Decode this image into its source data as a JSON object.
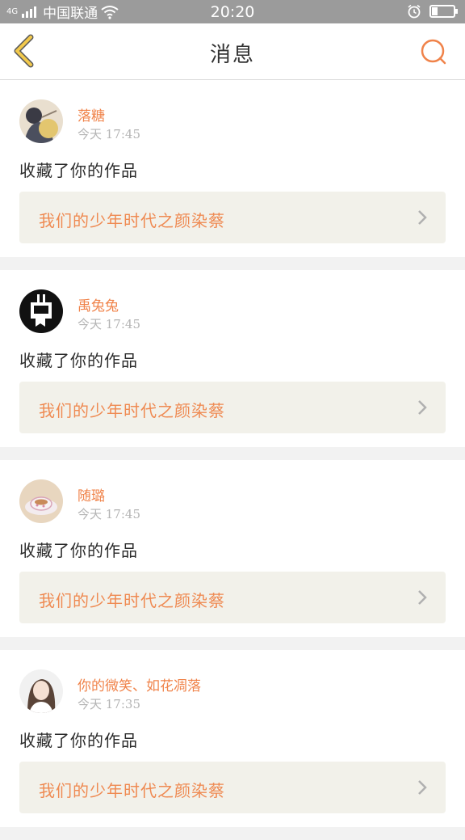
{
  "status_bar": {
    "network": "4G",
    "carrier": "中国联通",
    "time": "20:20",
    "battery_level": 0.25,
    "icons": [
      "signal-icon",
      "wifi-icon",
      "alarm-icon",
      "battery-icon"
    ]
  },
  "header": {
    "title": "消息",
    "back_icon": "chevron-left-icon",
    "search_icon": "search-icon"
  },
  "colors": {
    "accent": "#f0834a",
    "back_icon": "#f2c94c",
    "card_bg": "#f2f1ea",
    "divider": "#f2f2f2"
  },
  "messages": [
    {
      "user": "落糖",
      "time": "今天 17:45",
      "action": "收藏了你的作品",
      "work_title": "我们的少年时代之颜染蔡",
      "avatar": "photo-avatar-girl"
    },
    {
      "user": "禹兔兔",
      "time": "今天 17:45",
      "action": "收藏了你的作品",
      "work_title": "我们的少年时代之颜染蔡",
      "avatar": "logo-avatar-black"
    },
    {
      "user": "随璐",
      "time": "今天 17:45",
      "action": "收藏了你的作品",
      "work_title": "我们的少年时代之颜染蔡",
      "avatar": "photo-avatar-teacup"
    },
    {
      "user": "你的微笑、如花凋落",
      "time": "今天 17:35",
      "action": "收藏了你的作品",
      "work_title": "我们的少年时代之颜染蔡",
      "avatar": "photo-avatar-portrait"
    }
  ]
}
